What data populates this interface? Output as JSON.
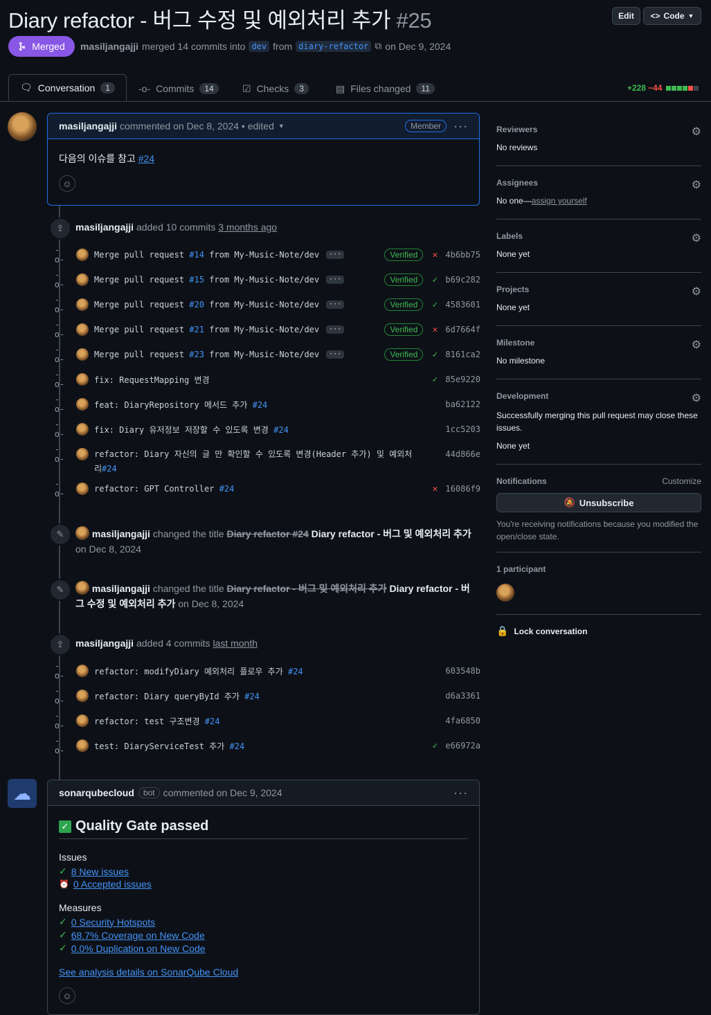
{
  "pr": {
    "title": "Diary refactor - 버그 수정 및 예외처리 추가",
    "number": "#25",
    "edit_label": "Edit",
    "code_label": "Code",
    "state_label": "Merged",
    "author": "masiljangajji",
    "merged_text": "merged 14 commits into",
    "base_branch": "dev",
    "from_text": "from",
    "head_branch": "diary-refactor",
    "date_text": "on Dec 9, 2024"
  },
  "tabs": [
    {
      "label": "Conversation",
      "count": "1"
    },
    {
      "label": "Commits",
      "count": "14"
    },
    {
      "label": "Checks",
      "count": "3"
    },
    {
      "label": "Files changed",
      "count": "11"
    }
  ],
  "diffstat": {
    "additions": "+228",
    "deletions": "−44"
  },
  "first_comment": {
    "author": "masiljangajji",
    "meta": "commented on Dec 8, 2024 • edited",
    "badge": "Member",
    "body": "다음의 이슈를 참고",
    "body_link": "#24"
  },
  "events": {
    "added1": {
      "author": "masiljangajji",
      "text": "added 10 commits",
      "time": "3 months ago"
    },
    "rename1": {
      "author": "masiljangajji",
      "text": "changed the title",
      "old": "Diary refactor #24",
      "new": "Diary refactor - 버그 및 예외처리 추가",
      "date": "on Dec 8, 2024"
    },
    "rename2": {
      "author": "masiljangajji",
      "text": "changed the title",
      "old": "Diary refactor - 버그 및 예외처리 추가",
      "new_a": "Diary refactor - 버",
      "new_b": "그 수정 및 예외처리 추가",
      "date": "on Dec 8, 2024"
    },
    "added2": {
      "author": "masiljangajji",
      "text": "added 4 commits",
      "time": "last month"
    }
  },
  "commits1": [
    {
      "msg": "Merge pull request ",
      "ref": "#14",
      "rest": " from My-Music-Note/dev",
      "ellipsis": true,
      "verified": "Verified",
      "status": "fail",
      "sha": "4b6bb75"
    },
    {
      "msg": "Merge pull request ",
      "ref": "#15",
      "rest": " from My-Music-Note/dev",
      "ellipsis": true,
      "verified": "Verified",
      "status": "ok",
      "sha": "b69c282"
    },
    {
      "msg": "Merge pull request ",
      "ref": "#20",
      "rest": " from My-Music-Note/dev",
      "ellipsis": true,
      "verified": "Verified",
      "status": "ok",
      "sha": "4583601"
    },
    {
      "msg": "Merge pull request ",
      "ref": "#21",
      "rest": " from My-Music-Note/dev",
      "ellipsis": true,
      "verified": "Verified",
      "status": "fail",
      "sha": "6d7664f"
    },
    {
      "msg": "Merge pull request ",
      "ref": "#23",
      "rest": " from My-Music-Note/dev",
      "ellipsis": true,
      "verified": "Verified",
      "status": "ok",
      "sha": "8161ca2"
    },
    {
      "msg": "fix: RequestMapping 변경",
      "ref": "",
      "rest": "",
      "ellipsis": false,
      "verified": "",
      "status": "ok",
      "sha": "85e9220"
    },
    {
      "msg": "feat: DiaryRepository 메서드 추가 ",
      "ref": "#24",
      "rest": "",
      "ellipsis": false,
      "verified": "",
      "status": "",
      "sha": "ba62122"
    },
    {
      "msg": "fix: Diary 유저정보 저장할 수 있도록 변경 ",
      "ref": "#24",
      "rest": "",
      "ellipsis": false,
      "verified": "",
      "status": "",
      "sha": "1cc5203"
    },
    {
      "msg": "refactor: Diary 자신의 글 만 확인할 수 있도록 변경(Header 추가) 및 예외처리",
      "ref": "#24",
      "rest": "",
      "ellipsis": false,
      "verified": "",
      "status": "",
      "sha": "44d866e",
      "wrap": true
    },
    {
      "msg": "refactor: GPT Controller ",
      "ref": "#24",
      "rest": "",
      "ellipsis": false,
      "verified": "",
      "status": "fail",
      "sha": "16086f9"
    }
  ],
  "commits2": [
    {
      "msg": "refactor: modifyDiary 예외처리 플로우 추가 ",
      "ref": "#24",
      "status": "",
      "sha": "603548b"
    },
    {
      "msg": "refactor: Diary queryById 추가 ",
      "ref": "#24",
      "status": "",
      "sha": "d6a3361"
    },
    {
      "msg": "refactor: test 구조변경 ",
      "ref": "#24",
      "status": "",
      "sha": "4fa6850"
    },
    {
      "msg": "test: DiaryServiceTest 추가 ",
      "ref": "#24",
      "status": "ok",
      "sha": "e66972a"
    }
  ],
  "sonar": {
    "author": "sonarqubecloud",
    "bot": "bot",
    "meta": "commented on Dec 9, 2024",
    "title": "Quality Gate passed",
    "issues_h": "Issues",
    "new_issues": "8 New issues",
    "accepted": "0 Accepted issues",
    "measures_h": "Measures",
    "hotspots": "0 Security Hotspots",
    "coverage": "68.7% Coverage on New Code",
    "duplication": "0.0% Duplication on New Code",
    "details": "See analysis details on SonarQube Cloud"
  },
  "sidebar": {
    "reviewers_h": "Reviewers",
    "reviewers_v": "No reviews",
    "assignees_h": "Assignees",
    "assignees_v": "No one—",
    "assignees_link": "assign yourself",
    "labels_h": "Labels",
    "labels_v": "None yet",
    "projects_h": "Projects",
    "projects_v": "None yet",
    "milestone_h": "Milestone",
    "milestone_v": "No milestone",
    "dev_h": "Development",
    "dev_desc": "Successfully merging this pull request may close these issues.",
    "dev_v": "None yet",
    "notif_h": "Notifications",
    "notif_customize": "Customize",
    "unsubscribe": "Unsubscribe",
    "notif_desc": "You're receiving notifications because you modified the open/close state.",
    "participants_h": "1 participant",
    "lock": "Lock conversation"
  },
  "colors": {
    "merged": "#8957e5",
    "link": "#4493f8",
    "ok": "#3fb950",
    "fail": "#f85149"
  }
}
